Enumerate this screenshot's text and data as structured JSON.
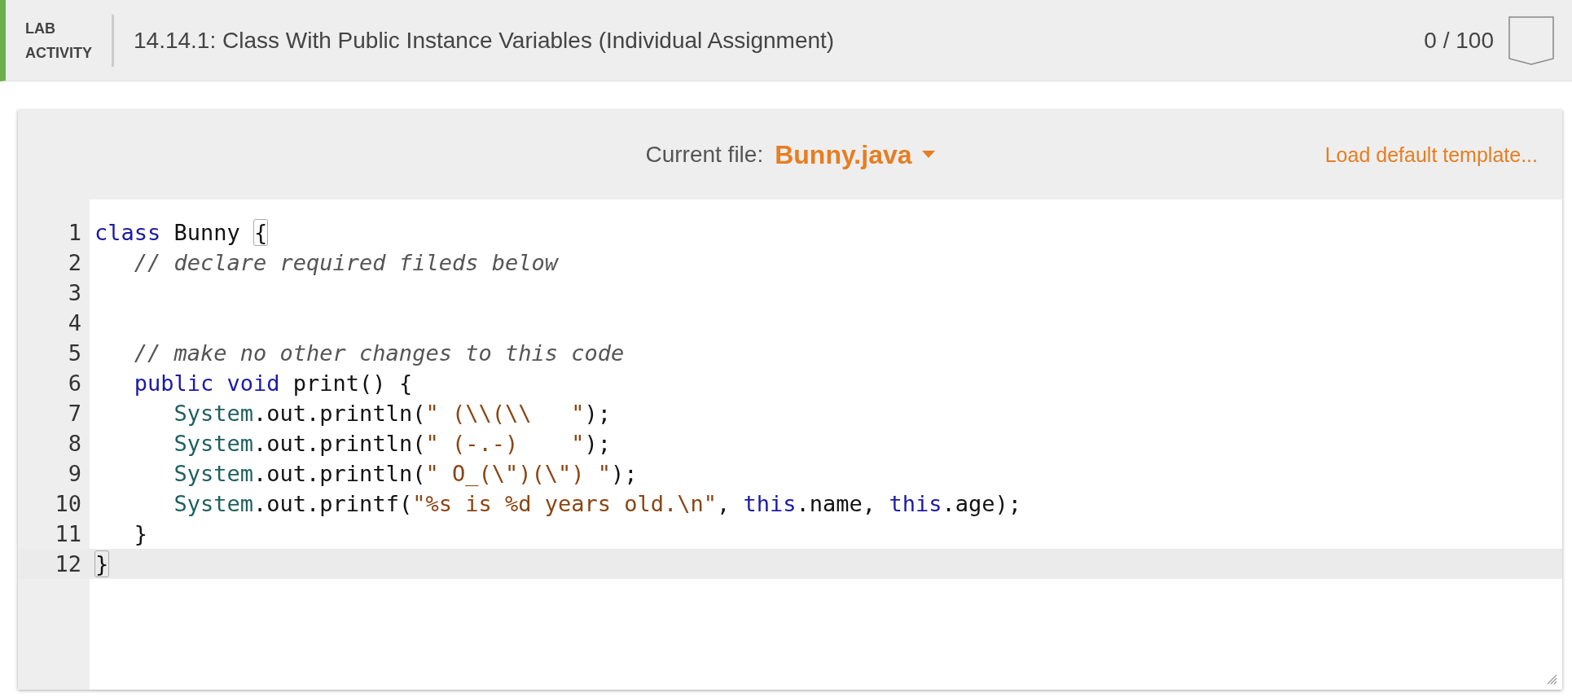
{
  "header": {
    "label": [
      "LAB",
      "ACTIVITY"
    ],
    "title": "14.14.1: Class With Public Instance Variables (Individual Assignment)",
    "score": "0 / 100"
  },
  "file_bar": {
    "caption": "Current file:",
    "file": "Bunny.java",
    "action": "Load default template..."
  },
  "editor": {
    "lines": [
      {
        "number": "1",
        "active": false,
        "tokens": [
          {
            "kind": "keyword",
            "text": "class"
          },
          {
            "kind": "plain",
            "text": " Bunny "
          },
          {
            "kind": "bracket",
            "text": "{"
          }
        ]
      },
      {
        "number": "2",
        "active": false,
        "tokens": [
          {
            "kind": "comment",
            "text": "   // declare required fileds below"
          }
        ]
      },
      {
        "number": "3",
        "active": false
      },
      {
        "number": "4",
        "active": false
      },
      {
        "number": "5",
        "active": false,
        "tokens": [
          {
            "kind": "comment",
            "text": "   // make no other changes to this code"
          }
        ]
      },
      {
        "number": "6",
        "active": false,
        "tokens": [
          {
            "kind": "keyword",
            "text": "   public void"
          },
          {
            "kind": "plain",
            "text": " print() {"
          }
        ]
      },
      {
        "number": "7",
        "active": false,
        "tokens": [
          {
            "kind": "type",
            "text": "      System"
          },
          {
            "kind": "plain",
            "text": ".out.println("
          },
          {
            "kind": "string",
            "text": "\" (\\\\(\\\\   \""
          },
          {
            "kind": "plain",
            "text": ");"
          }
        ]
      },
      {
        "number": "8",
        "active": false,
        "tokens": [
          {
            "kind": "type",
            "text": "      System"
          },
          {
            "kind": "plain",
            "text": ".out.println("
          },
          {
            "kind": "string",
            "text": "\" (-.-)    \""
          },
          {
            "kind": "plain",
            "text": ");"
          }
        ]
      },
      {
        "number": "9",
        "active": false,
        "tokens": [
          {
            "kind": "type",
            "text": "      System"
          },
          {
            "kind": "plain",
            "text": ".out.println("
          },
          {
            "kind": "string",
            "text": "\" O_(\\\")(\\\") \""
          },
          {
            "kind": "plain",
            "text": ");"
          }
        ]
      },
      {
        "number": "10",
        "active": false,
        "tokens": [
          {
            "kind": "type",
            "text": "      System"
          },
          {
            "kind": "plain",
            "text": ".out.printf("
          },
          {
            "kind": "string",
            "text": "\"%s is %d years old.\\n\""
          },
          {
            "kind": "plain",
            "text": ", "
          },
          {
            "kind": "keyword",
            "text": "this"
          },
          {
            "kind": "plain",
            "text": ".name, "
          },
          {
            "kind": "keyword",
            "text": "this"
          },
          {
            "kind": "plain",
            "text": ".age);"
          }
        ]
      },
      {
        "number": "11",
        "active": false,
        "tokens": [
          {
            "kind": "plain",
            "text": "   }"
          }
        ]
      },
      {
        "number": "12",
        "active": true,
        "tokens": [
          {
            "kind": "bracket",
            "text": "}"
          }
        ]
      }
    ]
  }
}
